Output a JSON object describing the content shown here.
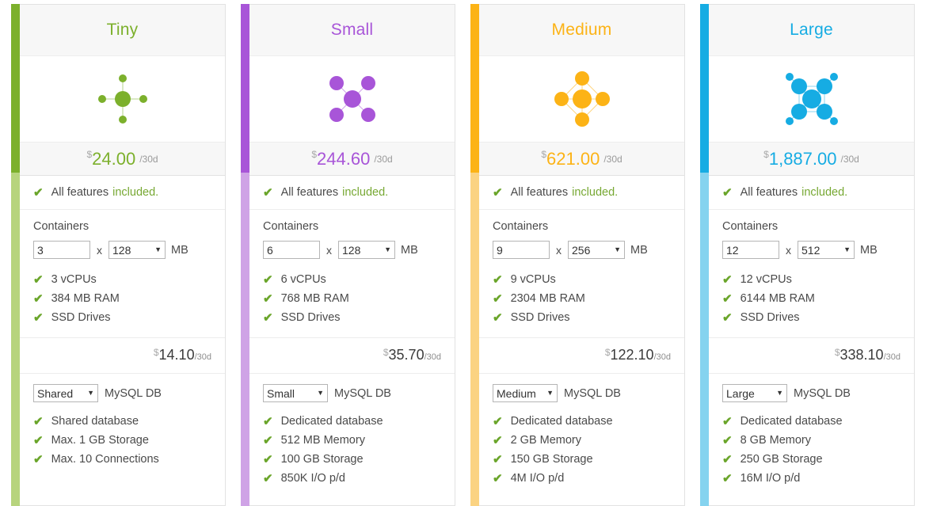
{
  "common": {
    "all_features_prefix": "All features",
    "all_features_highlight": "included.",
    "containers_label": "Containers",
    "times": "x",
    "mb_unit": "MB",
    "db_label": "MySQL DB",
    "currency": "$",
    "period": "/30d",
    "check_icon": "check-icon",
    "caret_icon": "chevron-down-icon"
  },
  "plans": [
    {
      "name": "Tiny",
      "accent": "#7cb02c",
      "accent_light": "#b7d47d",
      "price": "24.00",
      "icon": "plan-icon-tiny",
      "containers_count": "3",
      "containers_size": "128",
      "features": [
        "3 vCPUs",
        "384 MB RAM",
        "SSD Drives"
      ],
      "subtotal": "14.10",
      "db_tier": "Shared",
      "db_features": [
        "Shared database",
        "Max. 1 GB Storage",
        "Max. 10 Connections"
      ]
    },
    {
      "name": "Small",
      "accent": "#a855d8",
      "accent_light": "#cfa3e6",
      "price": "244.60",
      "icon": "plan-icon-small",
      "containers_count": "6",
      "containers_size": "128",
      "features": [
        "6 vCPUs",
        "768 MB RAM",
        "SSD Drives"
      ],
      "subtotal": "35.70",
      "db_tier": "Small",
      "db_features": [
        "Dedicated database",
        "512 MB Memory",
        "100 GB Storage",
        "850K I/O p/d"
      ]
    },
    {
      "name": "Medium",
      "accent": "#fcb316",
      "accent_light": "#fbd382",
      "price": "621.00",
      "icon": "plan-icon-medium",
      "containers_count": "9",
      "containers_size": "256",
      "features": [
        "9 vCPUs",
        "2304 MB RAM",
        "SSD Drives"
      ],
      "subtotal": "122.10",
      "db_tier": "Medium",
      "db_features": [
        "Dedicated database",
        "2 GB Memory",
        "150 GB Storage",
        "4M I/O p/d"
      ]
    },
    {
      "name": "Large",
      "accent": "#16ace3",
      "accent_light": "#85d3ef",
      "price": "1,887.00",
      "icon": "plan-icon-large",
      "containers_count": "12",
      "containers_size": "512",
      "features": [
        "12 vCPUs",
        "6144 MB RAM",
        "SSD Drives"
      ],
      "subtotal": "338.10",
      "db_tier": "Large",
      "db_features": [
        "Dedicated database",
        "8 GB Memory",
        "250 GB Storage",
        "16M I/O p/d"
      ]
    }
  ]
}
